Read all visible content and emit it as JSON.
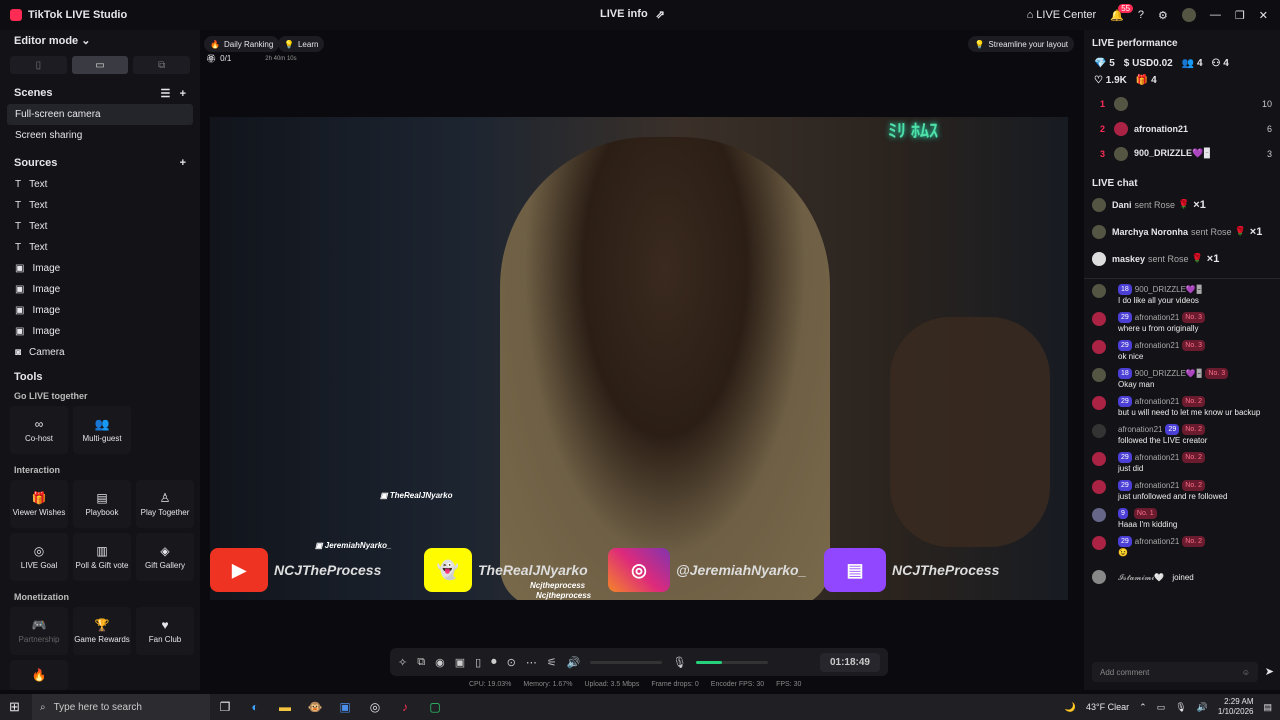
{
  "titlebar": {
    "app": "TikTok LIVE Studio",
    "center": "LIVE info",
    "live_center": "LIVE Center",
    "notif": "55"
  },
  "left": {
    "editor_mode": "Editor mode",
    "scenes_h": "Scenes",
    "scenes": [
      "Full-screen camera",
      "Screen sharing"
    ],
    "sources_h": "Sources",
    "sources": [
      "Text",
      "Text",
      "Text",
      "Text",
      "Image",
      "Image",
      "Image",
      "Image",
      "Camera"
    ],
    "tools_h": "Tools",
    "go_live": "Go LIVE together",
    "cohost": "Co-host",
    "multiguest": "Multi-guest",
    "interaction": "Interaction",
    "viewer_wishes": "Viewer Wishes",
    "playbook": "Playbook",
    "play_together": "Play Together",
    "live_goal": "LIVE Goal",
    "poll": "Poll & Gift vote",
    "gift_gallery": "Gift Gallery",
    "monetization": "Monetization",
    "partnership": "Partnership",
    "game_rewards": "Game Rewards",
    "fan_club": "Fan Club"
  },
  "center": {
    "daily": "Daily Ranking",
    "learn": "Learn",
    "streamline": "Streamline your layout",
    "progress": "0/1",
    "progress_time": "2h 40m 10s",
    "neon": "ﾐﾘ ﾎﾑｽ",
    "tag1": "TheRealJNyarko",
    "tag2": "JeremiahNyarko_",
    "tag3": "Ncjtheprocess",
    "tag4": "Ncjtheprocess",
    "yt": "NCJTheProcess",
    "snap": "TheRealJNyarko",
    "ig": "@JeremiahNyarko_",
    "tw": "NCJTheProcess",
    "timer": "01:18:49",
    "cpu": "CPU: 19.03%",
    "mem": "Memory: 1.67%",
    "up": "Upload: 3.5 Mbps",
    "drops": "Frame drops: 0",
    "efps": "Encoder FPS: 30",
    "fps": "FPS: 30"
  },
  "right": {
    "perf_h": "LIVE performance",
    "p1": "5",
    "p2": "USD0.02",
    "p3": "4",
    "p4": "4",
    "p5": "1.9K",
    "p6": "4",
    "ranks": [
      {
        "n": "1",
        "name": "",
        "v": "10"
      },
      {
        "n": "2",
        "name": "afronation21",
        "v": "6"
      },
      {
        "n": "3",
        "name": "900_DRIZZLE💜🁢",
        "v": "3"
      }
    ],
    "chat_h": "LIVE chat",
    "gifts": [
      {
        "u": "Dani",
        "s": "sent Rose",
        "x": "×1"
      },
      {
        "u": "Marchya Noronha",
        "s": "sent Rose",
        "x": "×1"
      },
      {
        "u": "maskey",
        "s": "sent Rose",
        "x": "×1"
      }
    ],
    "m1u": "900_DRIZZLE💜🁢",
    "m1l": "18",
    "m1t": "I do like all your videos",
    "m2u": "afronation21",
    "m2l": "29",
    "m2n": "No. 3",
    "m2t": "where u from originally",
    "m3u": "afronation21",
    "m3l": "29",
    "m3n": "No. 3",
    "m3t": "ok nice",
    "m4u": "900_DRIZZLE💜🁢",
    "m4l": "18",
    "m4n": "No. 3",
    "m4t": "Okay man",
    "m5u": "afronation21",
    "m5l": "29",
    "m5n": "No. 2",
    "m5t": "but u will need to let me know ur backup",
    "m6u": "afronation21",
    "m6l": "29",
    "m6n": "No. 2",
    "m6t": "followed the LIVE creator",
    "m7u": "afronation21",
    "m7l": "29",
    "m7n": "No. 2",
    "m7t": "just did",
    "m8u": "afronation21",
    "m8l": "29",
    "m8n": "No. 2",
    "m8t": "just unfollowed and re followed",
    "m9u": "",
    "m9l": "9",
    "m9n": "No. 1",
    "m9t": "Haaa I'm kidding",
    "m10u": "afronation21",
    "m10l": "29",
    "m10n": "No. 2",
    "m10t": "😉",
    "m11u": "𝓘𝓼𝓽𝓪𝓶𝓲𝓶𝓲🤍",
    "m11t": "joined",
    "comment": "Add comment"
  },
  "taskbar": {
    "search": "Type here to search",
    "weather": "43°F  Clear",
    "time": "2:29 AM",
    "date": "1/10/2026"
  }
}
